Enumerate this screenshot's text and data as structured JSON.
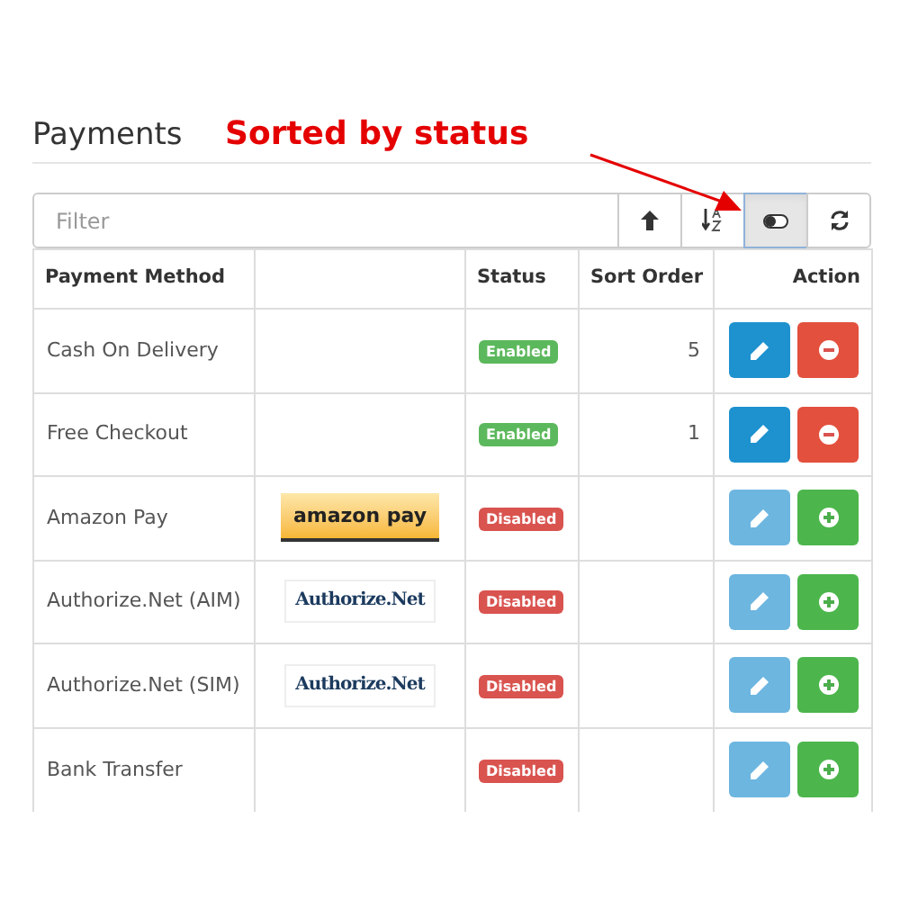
{
  "title": "Payments",
  "annotation": {
    "text": "Sorted by status"
  },
  "filter": {
    "placeholder": "Filter"
  },
  "toolbar": [
    {
      "kind": "up",
      "selected": false
    },
    {
      "kind": "sort",
      "selected": false
    },
    {
      "kind": "toggle",
      "selected": true
    },
    {
      "kind": "refresh",
      "selected": false
    }
  ],
  "columns": [
    "Payment Method",
    "Status",
    "Sort Order",
    "Action"
  ],
  "rows": [
    {
      "name": "Cash On Delivery",
      "status": "Enabled",
      "enabled": true,
      "sort_order": "5",
      "installed": true
    },
    {
      "name": "Free Checkout",
      "status": "Enabled",
      "enabled": true,
      "sort_order": "1",
      "installed": true
    },
    {
      "name": "Amazon Pay",
      "logo": {
        "kind": "amazon",
        "text": "amazon pay"
      },
      "status": "Disabled",
      "enabled": false,
      "installed": false
    },
    {
      "name": "Authorize.Net (AIM)",
      "logo": {
        "kind": "authorize",
        "text": "Authorize.Net"
      },
      "status": "Disabled",
      "enabled": false,
      "installed": false
    },
    {
      "name": "Authorize.Net (SIM)",
      "logo": {
        "kind": "authorize",
        "text": "Authorize.Net"
      },
      "status": "Disabled",
      "enabled": false,
      "installed": false
    },
    {
      "name": "Bank Transfer",
      "status": "Disabled",
      "enabled": false,
      "installed": false
    }
  ]
}
